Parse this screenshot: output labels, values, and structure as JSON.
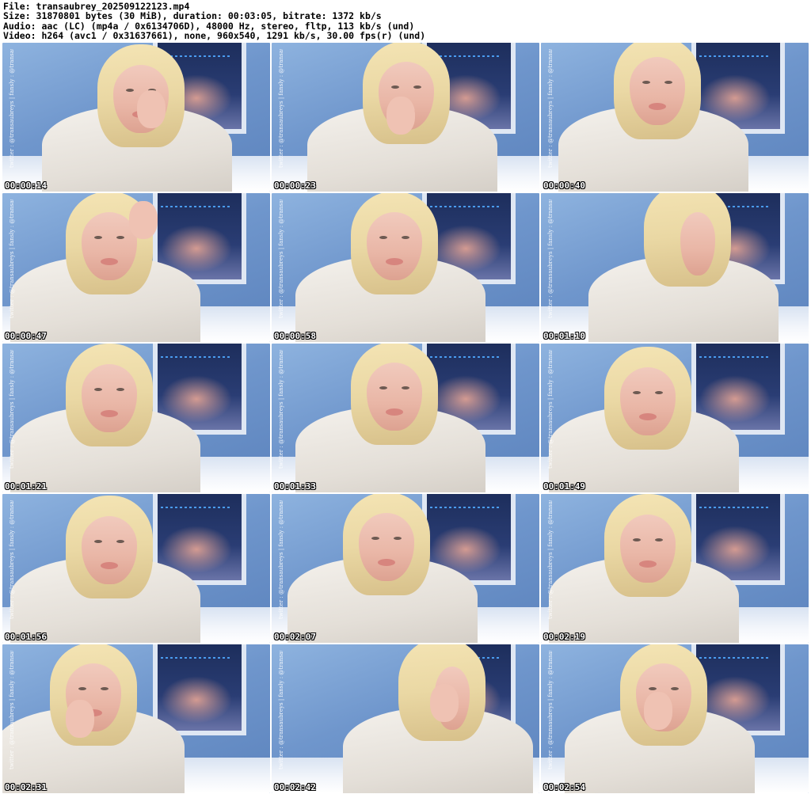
{
  "file_info": {
    "file_line": "File: transaubrey_202509122123.mp4",
    "size_line": "Size: 31870801 bytes (30 MiB), duration: 00:03:05, bitrate: 1372 kb/s",
    "audio_line": "Audio: aac (LC) (mp4a / 0x6134706D), 48000 Hz, stereo, fltp, 113 kb/s (und)",
    "video_line": "Video: h264 (avc1 / 0x31637661), none, 960x540, 1291 kb/s, 30.00 fps(r) (und)"
  },
  "watermark": "twitter : @transaubreys | fansly : @transaubrey",
  "colors": {
    "background": "#ffffff",
    "timestamp_text": "#ffffff",
    "timestamp_outline": "#000000",
    "wall": "#6f96cc",
    "window_led": "#4fa7ff",
    "hoodie": "#e4dfd8",
    "hair": "#ead8a4"
  },
  "thumbnails": [
    {
      "timestamp": "00:00:14"
    },
    {
      "timestamp": "00:00:23"
    },
    {
      "timestamp": "00:00:40"
    },
    {
      "timestamp": "00:00:47"
    },
    {
      "timestamp": "00:00:58"
    },
    {
      "timestamp": "00:01:10"
    },
    {
      "timestamp": "00:01:21"
    },
    {
      "timestamp": "00:01:33"
    },
    {
      "timestamp": "00:01:49"
    },
    {
      "timestamp": "00:01:56"
    },
    {
      "timestamp": "00:02:07"
    },
    {
      "timestamp": "00:02:19"
    },
    {
      "timestamp": "00:02:31"
    },
    {
      "timestamp": "00:02:42"
    },
    {
      "timestamp": "00:02:54"
    }
  ]
}
